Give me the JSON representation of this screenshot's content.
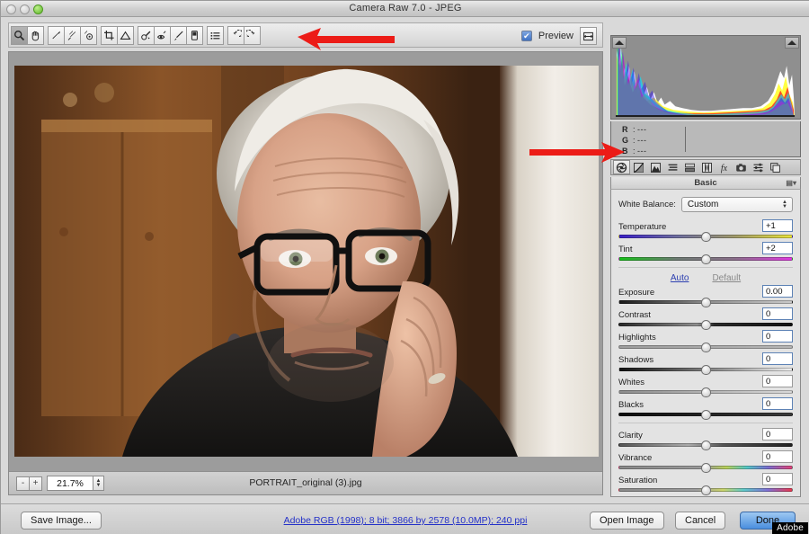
{
  "window": {
    "title": "Camera Raw 7.0  -  JPEG",
    "controls": [
      "close",
      "minimize",
      "zoom"
    ]
  },
  "toolbar": {
    "tools": [
      {
        "name": "zoom-tool",
        "icon": "magnifier",
        "active": true
      },
      {
        "name": "hand-tool",
        "icon": "hand",
        "active": false
      },
      {
        "name": "white-balance-tool",
        "icon": "eyedropper",
        "active": false
      },
      {
        "name": "color-sampler-tool",
        "icon": "color-sampler",
        "active": false
      },
      {
        "name": "targeted-adjustment-tool",
        "icon": "target",
        "active": false
      },
      {
        "name": "crop-tool",
        "icon": "crop",
        "active": false
      },
      {
        "name": "straighten-tool",
        "icon": "straighten",
        "active": false
      },
      {
        "name": "spot-removal-tool",
        "icon": "spot-removal",
        "active": false
      },
      {
        "name": "red-eye-removal-tool",
        "icon": "red-eye",
        "active": false
      },
      {
        "name": "adjustment-brush-tool",
        "icon": "brush",
        "active": false
      },
      {
        "name": "graduated-filter-tool",
        "icon": "graduated-filter",
        "active": false
      },
      {
        "name": "preset-list-tool",
        "icon": "list",
        "active": false
      },
      {
        "name": "rotate-left-tool",
        "icon": "rotate-ccw",
        "active": false
      },
      {
        "name": "rotate-right-tool",
        "icon": "rotate-cw",
        "active": false
      }
    ],
    "preview_label": "Preview",
    "preview_checked": true,
    "fullscreen_title": "Toggle full screen mode"
  },
  "canvas": {
    "filename": "PORTRAIT_original (3).jpg",
    "zoom_level": "21.7%",
    "zoom_out_label": "-",
    "zoom_in_label": "+"
  },
  "histogram": {
    "readout": [
      {
        "channel": "R",
        "value": "---"
      },
      {
        "channel": "G",
        "value": "---"
      },
      {
        "channel": "B",
        "value": "---"
      }
    ],
    "shadow_clip_title": "Shadow clipping warning",
    "highlight_clip_title": "Highlight clipping warning"
  },
  "panel_tabs": [
    {
      "name": "tab-basic",
      "icon": "aperture-icon",
      "label": "Basic",
      "active": true
    },
    {
      "name": "tab-tone-curve",
      "icon": "tone-curve-icon",
      "label": "Tone Curve",
      "active": false
    },
    {
      "name": "tab-detail",
      "icon": "detail-icon",
      "label": "Detail",
      "active": false
    },
    {
      "name": "tab-hsl-grayscale",
      "icon": "hsl-icon",
      "label": "HSL / Grayscale",
      "active": false
    },
    {
      "name": "tab-split-toning",
      "icon": "split-toning-icon",
      "label": "Split Toning",
      "active": false
    },
    {
      "name": "tab-lens-corrections",
      "icon": "lens-icon",
      "label": "Lens Corrections",
      "active": false
    },
    {
      "name": "tab-effects",
      "icon": "fx-icon",
      "label": "Effects",
      "active": false
    },
    {
      "name": "tab-camera-calibration",
      "icon": "camera-icon",
      "label": "Camera Calibration",
      "active": false
    },
    {
      "name": "tab-presets",
      "icon": "presets-icon",
      "label": "Presets",
      "active": false
    },
    {
      "name": "tab-snapshots",
      "icon": "snapshots-icon",
      "label": "Snapshots",
      "active": false
    }
  ],
  "basic_panel": {
    "title": "Basic",
    "white_balance": {
      "label": "White Balance:",
      "value": "Custom"
    },
    "auto_label": "Auto",
    "default_label": "Default",
    "sliders_wb": [
      {
        "name": "temperature",
        "label": "Temperature",
        "value": "+1",
        "pos": 50
      },
      {
        "name": "tint",
        "label": "Tint",
        "value": "+2",
        "pos": 50
      }
    ],
    "sliders_tone": [
      {
        "name": "exposure",
        "label": "Exposure",
        "value": "0.00",
        "pos": 50
      },
      {
        "name": "contrast",
        "label": "Contrast",
        "value": "0",
        "pos": 50
      },
      {
        "name": "highlights",
        "label": "Highlights",
        "value": "0",
        "pos": 50
      },
      {
        "name": "shadows",
        "label": "Shadows",
        "value": "0",
        "pos": 50
      },
      {
        "name": "whites",
        "label": "Whites",
        "value": "0",
        "pos": 50
      },
      {
        "name": "blacks",
        "label": "Blacks",
        "value": "0",
        "pos": 50
      }
    ],
    "sliders_presence": [
      {
        "name": "clarity",
        "label": "Clarity",
        "value": "0",
        "pos": 50
      },
      {
        "name": "vibrance",
        "label": "Vibrance",
        "value": "0",
        "pos": 50
      },
      {
        "name": "saturation",
        "label": "Saturation",
        "value": "0",
        "pos": 50
      }
    ]
  },
  "footer": {
    "save_image_label": "Save Image...",
    "workflow_options": "Adobe RGB (1998); 8 bit; 3866 by 2578 (10.0MP); 240 ppi",
    "open_image_label": "Open Image",
    "cancel_label": "Cancel",
    "done_label": "Done",
    "watermark": "Adobe"
  },
  "annotations": [
    {
      "name": "arrow-to-toolbar",
      "direction": "left",
      "color": "#ec1c17"
    },
    {
      "name": "arrow-to-panel-tabs",
      "direction": "right",
      "color": "#ec1c17"
    }
  ],
  "colors": {
    "accent_link": "#2431c8",
    "primary_button": "#4a8ede",
    "annotation_red": "#ec1c17",
    "panel_bg": "#e3e3e3"
  }
}
